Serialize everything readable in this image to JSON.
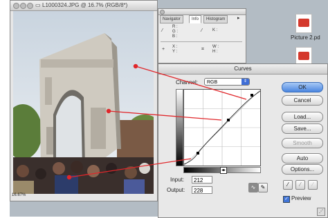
{
  "image_window": {
    "title": "L1000324.JPG @ 16.7% (RGB/8*)",
    "zoom_readout": "16.67%"
  },
  "info_palette": {
    "tabs": [
      "Navigator",
      "Info",
      "Histogram"
    ],
    "active_tab": "Info",
    "rgb_labels": "R :\nG :\nB :",
    "xy_labels": "X :\nY :",
    "wh_labels": "W :\nH :",
    "k_label": "K :"
  },
  "desktop_icons": [
    {
      "label": "Picture 2.pd"
    },
    {
      "label": ""
    }
  ],
  "curves_dialog": {
    "title": "Curves",
    "channel_label": "Channel:",
    "channel_value": "RGB",
    "input_label": "Input:",
    "input_value": "212",
    "output_label": "Output:",
    "output_value": "228",
    "buttons": {
      "ok": "OK",
      "cancel": "Cancel",
      "load": "Load...",
      "save": "Save...",
      "smooth": "Smooth",
      "auto": "Auto",
      "options": "Options..."
    },
    "preview_label": "Preview",
    "preview_checked": true
  },
  "colors": {
    "annotation_line": "#e0262a",
    "ok_button": "#4a86e0",
    "desktop": "#b3bcc4"
  }
}
